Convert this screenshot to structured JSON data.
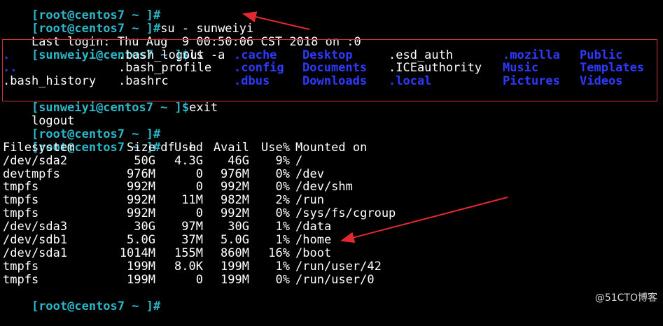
{
  "prompts": {
    "root": "[root@centos7 ~ ]#",
    "user": "[sunweiyi@centos7 ~ ]$"
  },
  "lines": {
    "l1_cmd": "",
    "l2_cmd": "su - sunweiyi",
    "l3_text": "Last login: Thu Aug  9 00:50:06 CST 2018 on :0",
    "l4_cmd": "ls -a",
    "l8_cmd": "exit",
    "l9_text": "logout",
    "l10_cmd": "",
    "l11_cmd": "df -h",
    "last_cmd": ""
  },
  "ls_output": {
    "row1": [
      ".",
      ".bash_logout",
      ".cache",
      "Desktop",
      ".esd_auth",
      ".mozilla",
      "Public"
    ],
    "row2": [
      "..",
      ".bash_profile",
      ".config",
      "Documents",
      ".ICEauthority",
      "Music",
      "Templates"
    ],
    "row3": [
      ".bash_history",
      ".bashrc",
      ".dbus",
      "Downloads",
      ".local",
      "Pictures",
      "Videos"
    ],
    "row1_dir": [
      true,
      false,
      true,
      true,
      false,
      true,
      true
    ],
    "row2_dir": [
      true,
      false,
      true,
      true,
      false,
      true,
      true
    ],
    "row3_dir": [
      false,
      false,
      true,
      true,
      true,
      true,
      true
    ]
  },
  "df": {
    "headers": [
      "Filesystem",
      "Size",
      "Used",
      "Avail",
      "Use%",
      "Mounted on"
    ],
    "rows": [
      [
        "/dev/sda2",
        "50G",
        "4.3G",
        "46G",
        "9%",
        "/"
      ],
      [
        "devtmpfs",
        "976M",
        "0",
        "976M",
        "0%",
        "/dev"
      ],
      [
        "tmpfs",
        "992M",
        "0",
        "992M",
        "0%",
        "/dev/shm"
      ],
      [
        "tmpfs",
        "992M",
        "11M",
        "982M",
        "2%",
        "/run"
      ],
      [
        "tmpfs",
        "992M",
        "0",
        "992M",
        "0%",
        "/sys/fs/cgroup"
      ],
      [
        "/dev/sda3",
        "30G",
        "97M",
        "30G",
        "1%",
        "/data"
      ],
      [
        "/dev/sdb1",
        "5.0G",
        "37M",
        "5.0G",
        "1%",
        "/home"
      ],
      [
        "/dev/sda1",
        "1014M",
        "155M",
        "860M",
        "16%",
        "/boot"
      ],
      [
        "tmpfs",
        "199M",
        "8.0K",
        "199M",
        "1%",
        "/run/user/42"
      ],
      [
        "tmpfs",
        "199M",
        "0",
        "199M",
        "0%",
        "/run/user/0"
      ]
    ]
  },
  "watermark": "@51CTO博客",
  "colors": {
    "prompt": "#2cb7c8",
    "directory": "#2e3bff",
    "text": "#ffffff",
    "background": "#000000",
    "annotation": "#e02a2f"
  }
}
